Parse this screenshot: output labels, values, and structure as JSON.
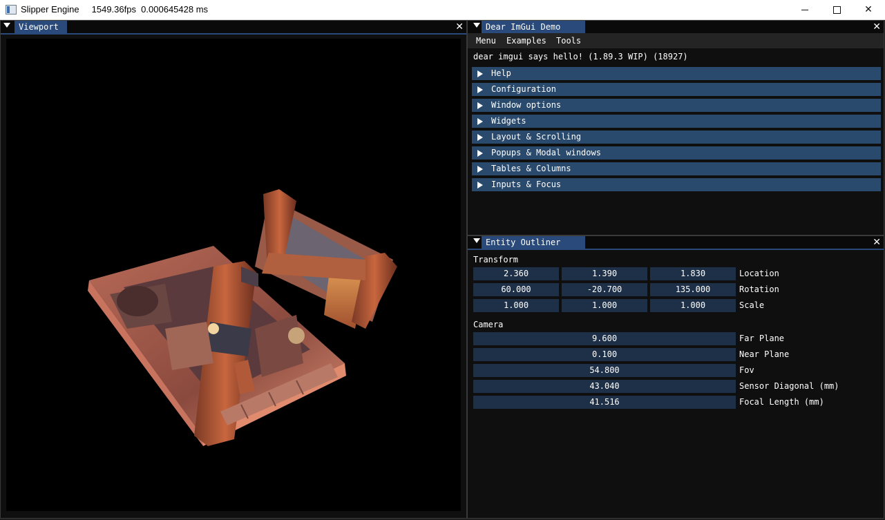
{
  "window": {
    "app_name": "Slipper Engine",
    "stats": "1549.36fps  0.000645428 ms"
  },
  "viewport": {
    "tab_label": "Viewport",
    "close_glyph": "✕"
  },
  "demo": {
    "tab_label": "Dear ImGui Demo",
    "close_glyph": "✕",
    "menu": [
      "Menu",
      "Examples",
      "Tools"
    ],
    "greeting": "dear imgui says hello! (1.89.3 WIP) (18927)",
    "sections": [
      "Help",
      "Configuration",
      "Window options",
      "Widgets",
      "Layout & Scrolling",
      "Popups & Modal windows",
      "Tables & Columns",
      "Inputs & Focus"
    ]
  },
  "outliner": {
    "tab_label": "Entity Outliner",
    "close_glyph": "✕",
    "transform_heading": "Transform",
    "transform": [
      {
        "values": [
          "2.360",
          "1.390",
          "1.830"
        ],
        "label": "Location"
      },
      {
        "values": [
          "60.000",
          "-20.700",
          "135.000"
        ],
        "label": "Rotation"
      },
      {
        "values": [
          "1.000",
          "1.000",
          "1.000"
        ],
        "label": "Scale"
      }
    ],
    "camera_heading": "Camera",
    "camera": [
      {
        "value": "9.600",
        "label": "Far Plane"
      },
      {
        "value": "0.100",
        "label": "Near Plane"
      },
      {
        "value": "54.800",
        "label": "Fov"
      },
      {
        "value": "43.040",
        "label": "Sensor Diagonal (mm)"
      },
      {
        "value": "41.516",
        "label": "Focal Length (mm)"
      }
    ]
  },
  "colors": {
    "tab_active": "#294a7a",
    "header": "#2a4a6d",
    "field": "#1d3048",
    "window_bg": "#0f0f0f"
  }
}
